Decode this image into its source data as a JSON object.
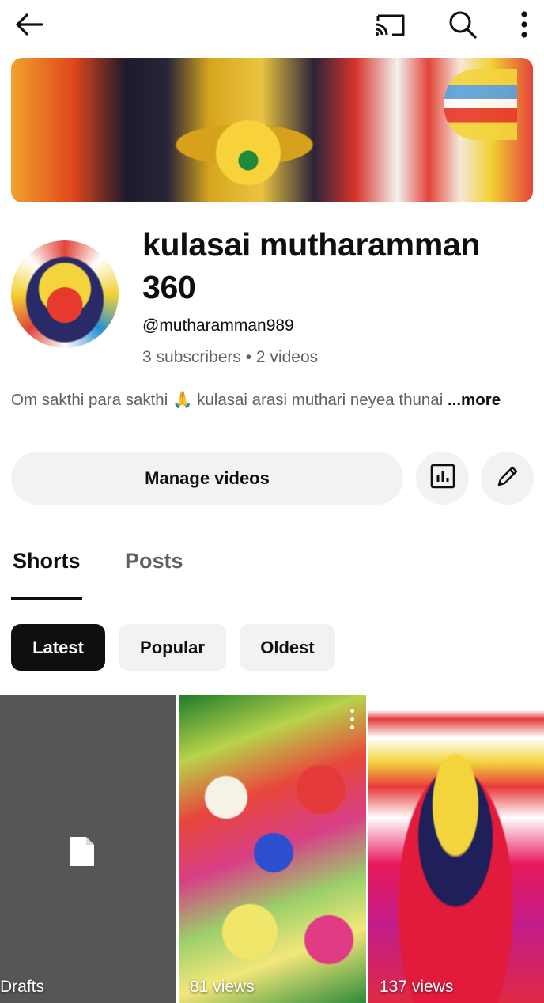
{
  "topbar": {
    "back_icon": "back-arrow-icon",
    "cast_icon": "cast-icon",
    "search_icon": "search-icon",
    "more_icon": "more-vert-icon"
  },
  "channel": {
    "name": "kulasai mutharamman 360",
    "handle": "@mutharamman989",
    "stats": "3 subscribers • 2 videos",
    "description": "Om sakthi para sakthi 🙏 kulasai arasi muthari neyea thunai",
    "more_label": "...more"
  },
  "actions": {
    "manage_label": "Manage videos",
    "analytics_icon": "analytics-icon",
    "edit_icon": "pencil-icon"
  },
  "tabs": [
    {
      "label": "Shorts",
      "selected": true
    },
    {
      "label": "Posts",
      "selected": false
    }
  ],
  "chips": [
    {
      "label": "Latest",
      "selected": true
    },
    {
      "label": "Popular",
      "selected": false
    },
    {
      "label": "Oldest",
      "selected": false
    }
  ],
  "grid": [
    {
      "label": "Drafts",
      "icon": "document-icon"
    },
    {
      "label": "81 views"
    },
    {
      "label": "137 views"
    }
  ],
  "colors": {
    "text_primary": "#0f0f0f",
    "text_secondary": "#606060",
    "chip_bg": "#f2f2f2",
    "chip_selected_bg": "#0f0f0f",
    "drafts_bg": "#565656"
  }
}
